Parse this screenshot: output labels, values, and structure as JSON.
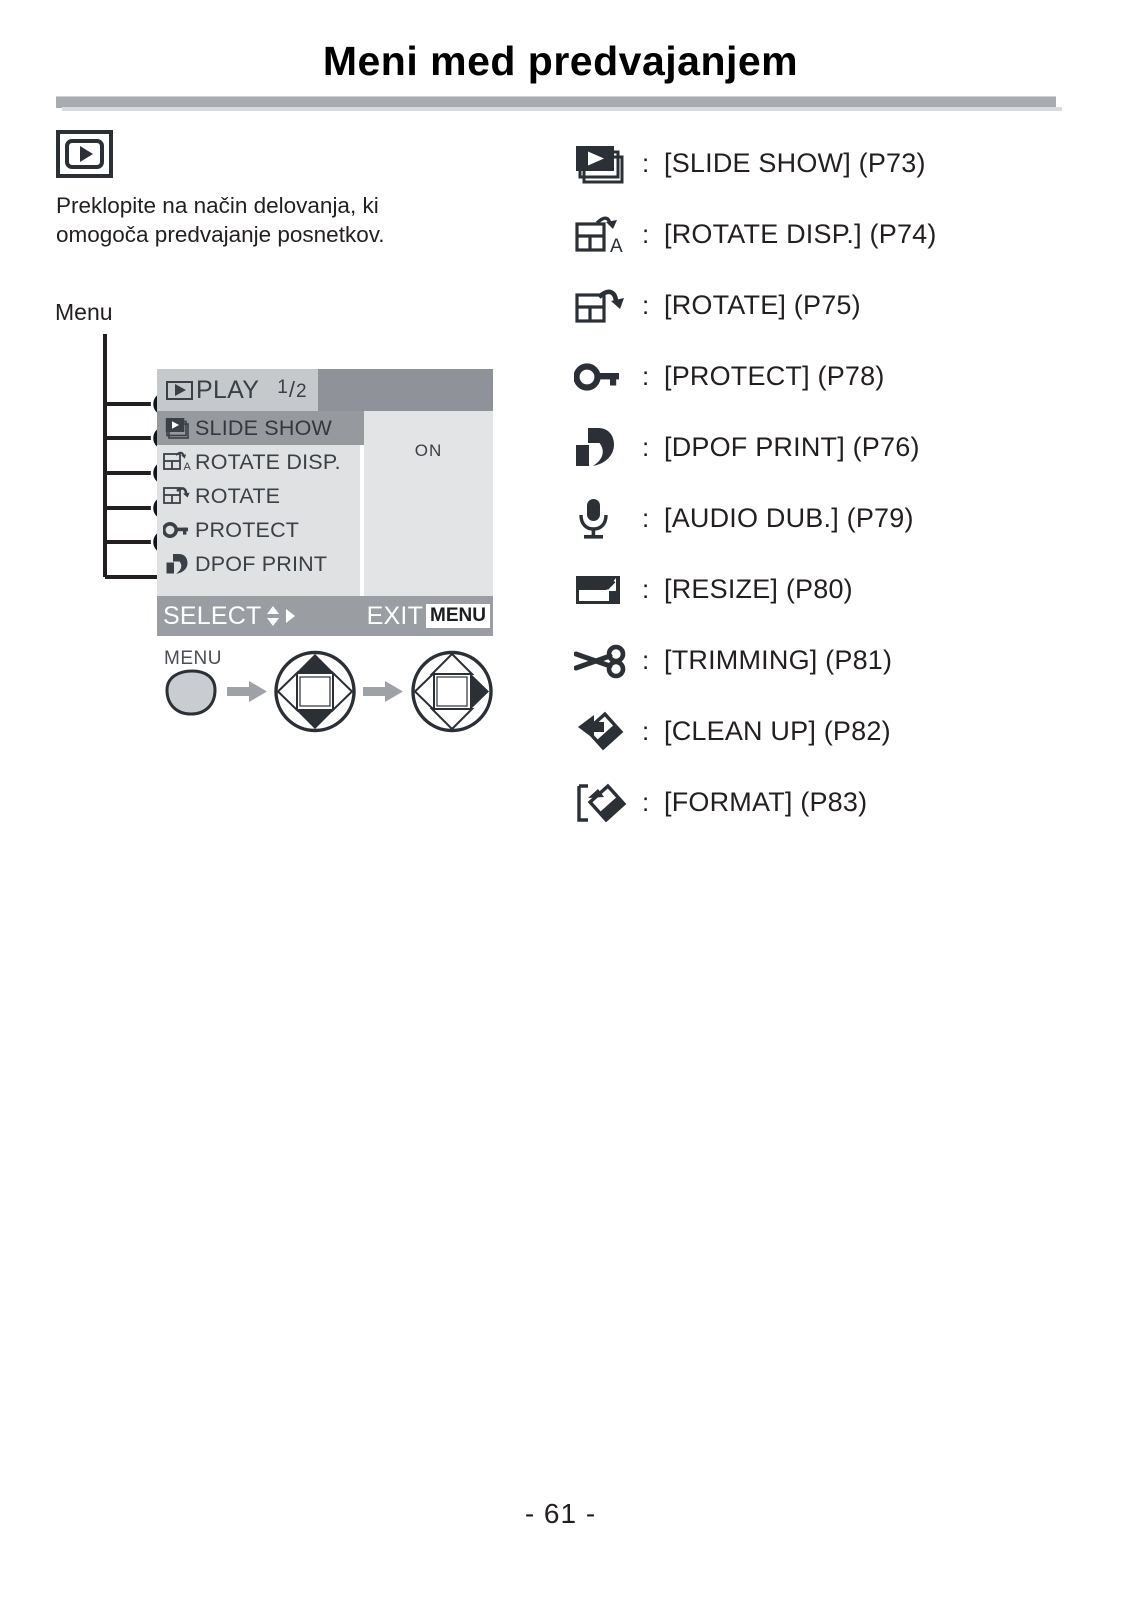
{
  "page": {
    "title": "Meni med predvajanjem",
    "page_number": "- 61 -"
  },
  "mode": {
    "icon": "playback-mode-icon",
    "description": "Preklopite na način delovanja, ki\nomogoča predvajanje posnetkov."
  },
  "menu_callout": {
    "label": "Menu"
  },
  "lcd": {
    "tab": {
      "icon": "play-icon",
      "label": "PLAY",
      "page_numerator": "1",
      "page_separator": "/",
      "page_denominator": "2"
    },
    "rows": [
      {
        "icon": "slide-show-icon",
        "label": "SLIDE SHOW",
        "selected": true,
        "value": ""
      },
      {
        "icon": "rotate-disp-icon",
        "label": "ROTATE DISP.",
        "selected": false,
        "value": "ON"
      },
      {
        "icon": "rotate-icon",
        "label": "ROTATE",
        "selected": false,
        "value": ""
      },
      {
        "icon": "protect-key-icon",
        "label": "PROTECT",
        "selected": false,
        "value": ""
      },
      {
        "icon": "dpof-print-icon",
        "label": "DPOF PRINT",
        "selected": false,
        "value": ""
      }
    ],
    "value_shown": "ON",
    "footer": {
      "select_label": "SELECT",
      "exit_label": "EXIT",
      "menu_chip": "MENU"
    }
  },
  "button_flow": {
    "menu_button_label": "MENU",
    "steps": [
      "menu-button",
      "arrow-right",
      "four-way-updown",
      "arrow-right",
      "four-way-right"
    ]
  },
  "legend": [
    {
      "icon": "slide-show-icon",
      "separator": ":",
      "text": "[SLIDE SHOW] (P73)"
    },
    {
      "icon": "rotate-disp-icon",
      "separator": ":",
      "text": "[ROTATE DISP.] (P74)"
    },
    {
      "icon": "rotate-icon",
      "separator": ":",
      "text": "[ROTATE] (P75)"
    },
    {
      "icon": "protect-key-icon",
      "separator": ":",
      "text": "[PROTECT] (P78)"
    },
    {
      "icon": "dpof-print-icon",
      "separator": ":",
      "text": "[DPOF PRINT] (P76)"
    },
    {
      "icon": "microphone-icon",
      "separator": ":",
      "text": "[AUDIO DUB.] (P79)"
    },
    {
      "icon": "resize-icon",
      "separator": ":",
      "text": "[RESIZE] (P80)"
    },
    {
      "icon": "scissors-icon",
      "separator": ":",
      "text": "[TRIMMING] (P81)"
    },
    {
      "icon": "clean-up-icon",
      "separator": ":",
      "text": "[CLEAN UP] (P82)"
    },
    {
      "icon": "format-icon",
      "separator": ":",
      "text": "[FORMAT] (P83)"
    }
  ],
  "colors": {
    "ink": "#231f20",
    "lcd_body": "#dfe1e3",
    "lcd_header": "#8f9399",
    "lcd_tab": "#c6c9cc",
    "lcd_selected": "#969a9f",
    "lcd_footer": "#9a9ea3",
    "icon_dark": "#2b3036",
    "rule": "#a8abaf"
  }
}
